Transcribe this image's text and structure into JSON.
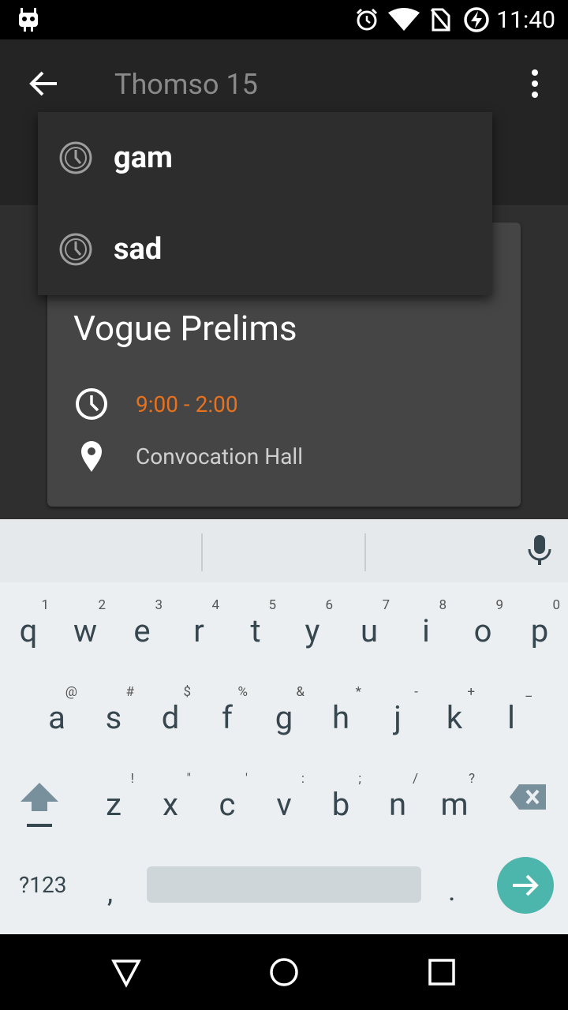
{
  "status_bar": {
    "time": "11:40"
  },
  "app_bar": {
    "title": "Thomso 15",
    "tab_peek": "3"
  },
  "dropdown": {
    "items": [
      {
        "label": "gam",
        "icon": "history-clock-icon"
      },
      {
        "label": "sad",
        "icon": "history-clock-icon"
      }
    ]
  },
  "card": {
    "title": "Vogue Prelims",
    "time": "9:00 - 2:00",
    "location": "Convocation Hall",
    "time_color": "#e8711d"
  },
  "keyboard": {
    "row1": [
      {
        "k": "q",
        "h": "1"
      },
      {
        "k": "w",
        "h": "2"
      },
      {
        "k": "e",
        "h": "3"
      },
      {
        "k": "r",
        "h": "4"
      },
      {
        "k": "t",
        "h": "5"
      },
      {
        "k": "y",
        "h": "6"
      },
      {
        "k": "u",
        "h": "7"
      },
      {
        "k": "i",
        "h": "8"
      },
      {
        "k": "o",
        "h": "9"
      },
      {
        "k": "p",
        "h": "0"
      }
    ],
    "row2": [
      {
        "k": "a",
        "h": "@"
      },
      {
        "k": "s",
        "h": "#"
      },
      {
        "k": "d",
        "h": "$"
      },
      {
        "k": "f",
        "h": "%"
      },
      {
        "k": "g",
        "h": "&"
      },
      {
        "k": "h",
        "h": "*"
      },
      {
        "k": "j",
        "h": "-"
      },
      {
        "k": "k",
        "h": "+"
      },
      {
        "k": "l",
        "h": "_"
      }
    ],
    "row3": [
      {
        "k": "z",
        "h": "!"
      },
      {
        "k": "x",
        "h": "\""
      },
      {
        "k": "c",
        "h": "'"
      },
      {
        "k": "v",
        "h": ":"
      },
      {
        "k": "b",
        "h": ";"
      },
      {
        "k": "n",
        "h": "/"
      },
      {
        "k": "m",
        "h": "?"
      }
    ],
    "sym_label": "?123",
    "comma": ",",
    "period": ".",
    "accent": "#4db6ac"
  }
}
